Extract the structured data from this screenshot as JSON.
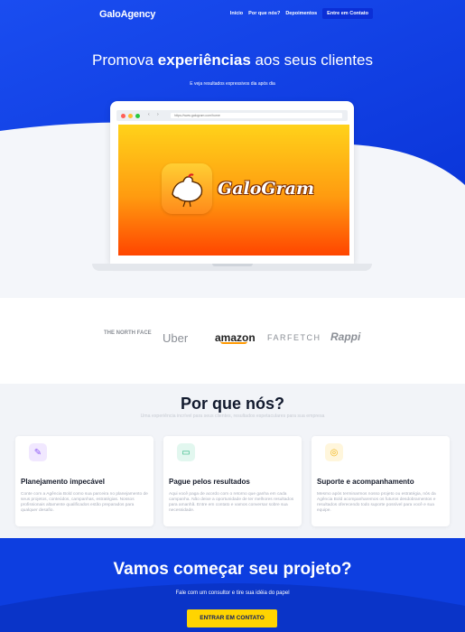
{
  "nav": {
    "logo": "GaloAgency",
    "links": [
      "Início",
      "Por que nós?",
      "Depoimentos"
    ],
    "cta": "Entre em Contato"
  },
  "hero": {
    "title_pre": "Promova ",
    "title_bold": "experiências",
    "title_post": " aos seus clientes",
    "subtitle": "E veja resultados expressivos dia após dia",
    "url": "https://www.galogram.com/home",
    "app_name": "GaloGram"
  },
  "brands": [
    "THE NORTH FACE",
    "Uber",
    "amazon",
    "FARFETCH",
    "Rappi"
  ],
  "why": {
    "title": "Por que nós?",
    "subtitle": "Uma experiência incrível para seus clientes, resultados espetaculares para sua empresa",
    "cards": [
      {
        "icon": "notes-icon",
        "title": "Planejamento impecável",
        "text": "Conte com a Agência Bold como sua parceira no planejamento de seus projetos, conteúdos, campanhas, estratégias. Nossos profissionais altamente qualificados estão preparados para qualquer desafio."
      },
      {
        "icon": "monitor-chart-icon",
        "title": "Pague pelos resultados",
        "text": "Aqui você paga de acordo com o retorno que ganha em cada campanha. Não deixe a oportunidade de ter melhores resultados para amanhã. Entre em contato e vamos conversar sobre sua necessidade."
      },
      {
        "icon": "lifebuoy-icon",
        "title": "Suporte e acompanhamento",
        "text": "Mesmo após terminarmos nosso projeto ou estratégia, nós da Agência Bold acompanharemos os futuros desdobramentos e resultados oferecendo todo suporte possível para você e sua equipe."
      }
    ]
  },
  "cta": {
    "title": "Vamos começar seu projeto?",
    "subtitle": "Fale com um consultor e tire sua idéia do papel",
    "button": "ENTRAR EM CONTATO"
  },
  "colors": {
    "primary": "#0d3ee0",
    "accent": "#ffd400"
  }
}
